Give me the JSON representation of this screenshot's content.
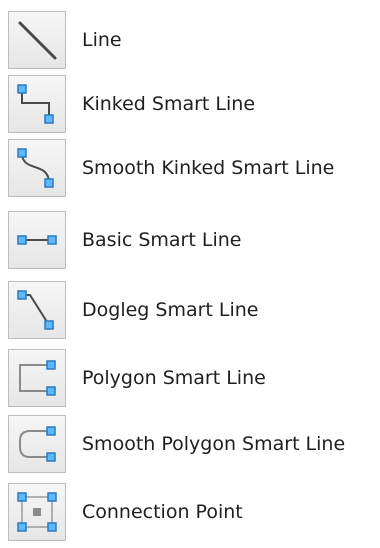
{
  "colors": {
    "icon_bg_top": "#f6f6f6",
    "icon_bg_bottom": "#e6e6e6",
    "icon_border": "#bdbdbd",
    "node_fill": "#5eb8ff",
    "node_stroke": "#2b7ac0",
    "line_stroke": "#4a4a4a",
    "shape_stroke": "#8a8a8a"
  },
  "menu": {
    "items": [
      {
        "label": "Line",
        "icon": "line-icon"
      },
      {
        "label": "Kinked Smart Line",
        "icon": "kinked-smart-line-icon"
      },
      {
        "label": "Smooth Kinked Smart Line",
        "icon": "smooth-kinked-smart-line-icon"
      },
      {
        "label": "Basic Smart Line",
        "icon": "basic-smart-line-icon"
      },
      {
        "label": "Dogleg Smart Line",
        "icon": "dogleg-smart-line-icon"
      },
      {
        "label": "Polygon Smart Line",
        "icon": "polygon-smart-line-icon"
      },
      {
        "label": "Smooth Polygon Smart Line",
        "icon": "smooth-polygon-smart-line-icon"
      },
      {
        "label": "Connection Point",
        "icon": "connection-point-icon"
      }
    ]
  }
}
